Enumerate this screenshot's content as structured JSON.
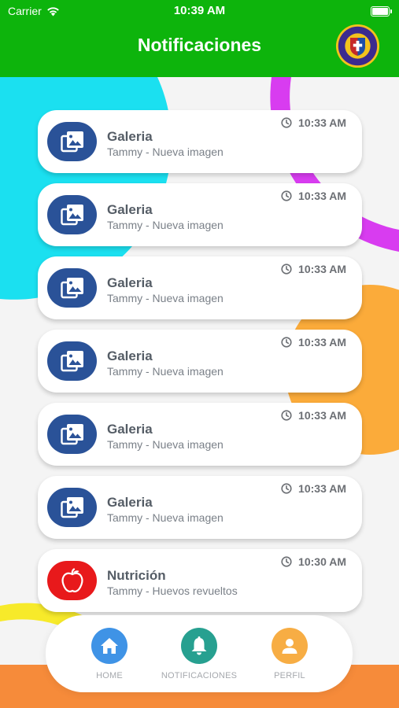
{
  "status_bar": {
    "carrier": "Carrier",
    "time": "10:39 AM"
  },
  "header": {
    "title": "Notificaciones",
    "logo_text": "COLEGIO SAN PEDRO CLAVER"
  },
  "colors": {
    "header_green": "#0db40c",
    "gallery_blue": "#2a5298",
    "nutrition_red": "#e8191b",
    "home_blue": "#3f93e6",
    "notifications_teal": "#27a090",
    "profile_orange": "#f7ad44"
  },
  "notifications": [
    {
      "icon": "gallery-icon",
      "title": "Galeria",
      "subtitle": "Tammy - Nueva imagen",
      "time": "10:33 AM"
    },
    {
      "icon": "gallery-icon",
      "title": "Galeria",
      "subtitle": "Tammy - Nueva imagen",
      "time": "10:33 AM"
    },
    {
      "icon": "gallery-icon",
      "title": "Galeria",
      "subtitle": "Tammy - Nueva imagen",
      "time": "10:33 AM"
    },
    {
      "icon": "gallery-icon",
      "title": "Galeria",
      "subtitle": "Tammy - Nueva imagen",
      "time": "10:33 AM"
    },
    {
      "icon": "gallery-icon",
      "title": "Galeria",
      "subtitle": "Tammy - Nueva imagen",
      "time": "10:33 AM"
    },
    {
      "icon": "gallery-icon",
      "title": "Galeria",
      "subtitle": "Tammy - Nueva imagen",
      "time": "10:33 AM"
    },
    {
      "icon": "apple-icon",
      "title": "Nutrición",
      "subtitle": "Tammy - Huevos revueltos",
      "time": "10:30 AM"
    }
  ],
  "bottom_nav": {
    "items": [
      {
        "label": "HOME",
        "icon": "home-icon"
      },
      {
        "label": "NOTIFICACIONES",
        "icon": "bell-icon"
      },
      {
        "label": "PERFIL",
        "icon": "user-icon"
      }
    ]
  }
}
